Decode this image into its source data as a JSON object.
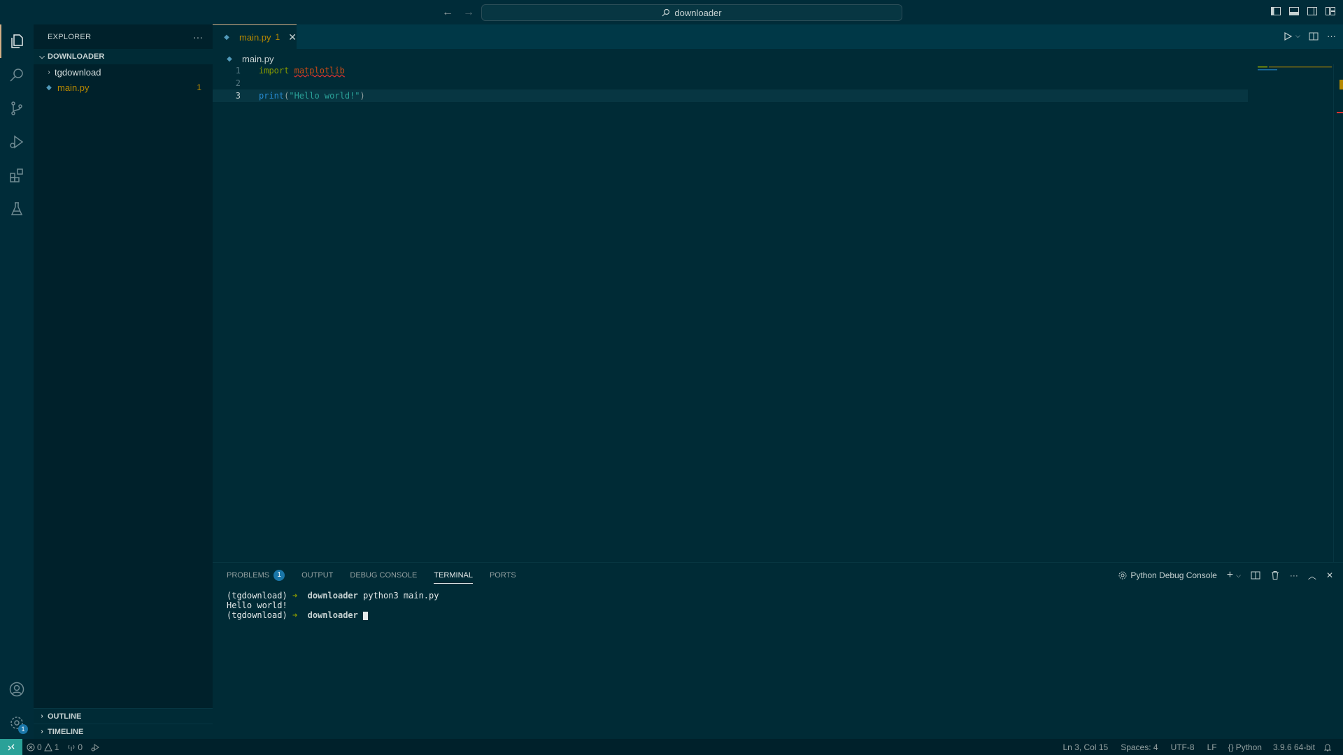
{
  "titlebar": {
    "search_text": "downloader"
  },
  "activity": {
    "settings_badge": "1"
  },
  "explorer": {
    "title": "EXPLORER",
    "folder": "DOWNLOADER",
    "items": [
      {
        "label": "tgdownload",
        "type": "folder"
      },
      {
        "label": "main.py",
        "type": "file",
        "problems": "1"
      }
    ],
    "outline": "OUTLINE",
    "timeline": "TIMELINE"
  },
  "editor": {
    "tab": {
      "label": "main.py",
      "problems": "1"
    },
    "breadcrumb": "main.py",
    "lines": [
      {
        "num": "1"
      },
      {
        "num": "2"
      },
      {
        "num": "3"
      }
    ],
    "code": {
      "l1_kw": "import",
      "l1_mod": "matplotlib",
      "l3_fn": "print",
      "l3_open": "(",
      "l3_str": "\"Hello world!\"",
      "l3_close": ")"
    }
  },
  "panel": {
    "tabs": [
      {
        "label": "PROBLEMS",
        "badge": "1"
      },
      {
        "label": "OUTPUT"
      },
      {
        "label": "DEBUG CONSOLE"
      },
      {
        "label": "TERMINAL"
      },
      {
        "label": "PORTS"
      }
    ],
    "terminal_name": "Python Debug Console",
    "terminal": {
      "env": "(tgdownload)",
      "arrow": "➜",
      "dir": "downloader",
      "command": "python3 main.py",
      "output": "Hello world!"
    }
  },
  "status": {
    "errors": "0",
    "warnings": "1",
    "ports": "0",
    "position": "Ln 3, Col 15",
    "spaces": "Spaces: 4",
    "encoding": "UTF-8",
    "eol": "LF",
    "language": "Python",
    "interpreter": "3.9.6 64-bit"
  },
  "colors": {
    "background": "#002b36",
    "sidebar": "#00212b",
    "accent": "#2aa198",
    "warning": "#b58900",
    "keyword": "#859900",
    "function": "#268bd2"
  }
}
